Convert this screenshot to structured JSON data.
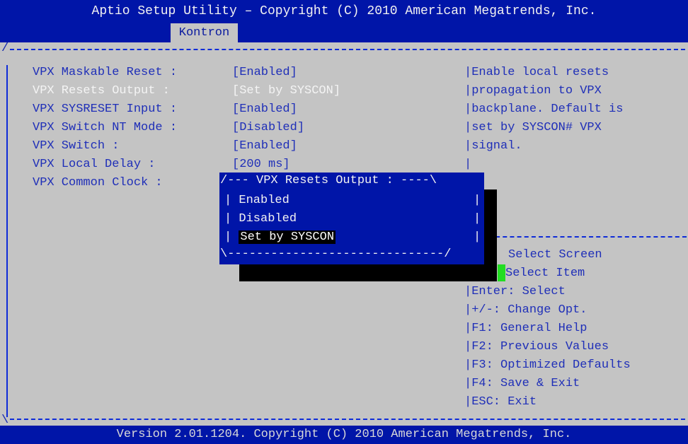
{
  "title": "Aptio Setup Utility – Copyright (C) 2010 American Megatrends, Inc.",
  "tab": "Kontron",
  "menu_items": [
    {
      "label": "VPX Maskable Reset :",
      "value": "[Enabled]"
    },
    {
      "label": "VPX Resets Output :",
      "value": "[Set by SYSCON]"
    },
    {
      "label": "VPX SYSRESET Input :",
      "value": "[Enabled]"
    },
    {
      "label": "VPX Switch NT Mode :",
      "value": "[Disabled]"
    },
    {
      "label": "VPX Switch :",
      "value": "[Enabled]"
    },
    {
      "label": "VPX Local Delay :",
      "value": "[200 ms]"
    },
    {
      "label": "VPX Common Clock :",
      "value": ""
    }
  ],
  "help_lines": [
    "Enable local resets",
    "propagation to VPX",
    "backplane. Default is",
    "set by SYSCON# VPX",
    "signal."
  ],
  "popup": {
    "title": "--- VPX Resets Output : ----",
    "options": [
      "Enabled",
      "Disabled",
      "Set by SYSCON"
    ],
    "selected": "Set by SYSCON"
  },
  "keys": [
    "Select Screen",
    "Select Item",
    "Enter: Select",
    "+/-: Change Opt.",
    "F1: General Help",
    "F2: Previous Values",
    "F3: Optimized Defaults",
    "F4: Save & Exit",
    "ESC: Exit"
  ],
  "footer": "Version 2.01.1204. Copyright (C) 2010 American Megatrends, Inc.",
  "colors": {
    "background": "#c4c4c4",
    "bar_blue": "#0015a8",
    "highlight_green": "#22dd22"
  }
}
